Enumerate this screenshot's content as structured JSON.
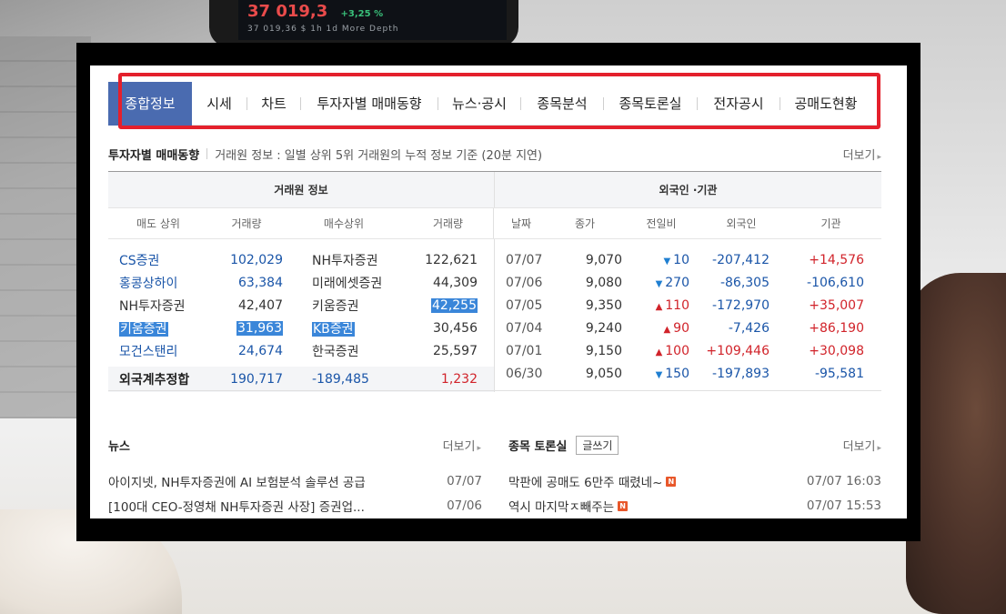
{
  "phone": {
    "price": "37 019,3",
    "change": "+3,25 %",
    "sub": "37 019,36 $    1h   1d   More   Depth"
  },
  "tabs": [
    "종합정보",
    "시세",
    "차트",
    "투자자별 매매동향",
    "뉴스·공시",
    "종목분석",
    "종목토론실",
    "전자공시",
    "공매도현황"
  ],
  "section": {
    "title": "투자자별 매매동향",
    "desc": "거래원 정보 : 일별 상위 5위 거래원의 누적 정보 기준 (20분 지연)",
    "more": "더보기"
  },
  "table": {
    "group_left": "거래원 정보",
    "group_right": "외국인 ·기관",
    "cols_left": [
      "매도 상위",
      "거래량",
      "매수상위",
      "거래량"
    ],
    "cols_right": [
      "날짜",
      "종가",
      "전일비",
      "외국인",
      "기관"
    ],
    "brokers": [
      {
        "sell": "CS증권",
        "sell_vol": "102,029",
        "buy": "NH투자증권",
        "buy_vol": "122,621"
      },
      {
        "sell": "홍콩상하이",
        "sell_vol": "63,384",
        "buy": "미래에셋증권",
        "buy_vol": "44,309"
      },
      {
        "sell": "NH투자증권",
        "sell_vol": "42,407",
        "buy": "키움증권",
        "buy_vol": "42,255"
      },
      {
        "sell": "키움증권",
        "sell_vol": "31,963",
        "buy": "KB증권",
        "buy_vol": "30,456"
      },
      {
        "sell": "모건스탠리",
        "sell_vol": "24,674",
        "buy": "한국증권",
        "buy_vol": "25,597"
      }
    ],
    "summary": {
      "label": "외국계추정합",
      "sell": "190,717",
      "buy": "-189,485",
      "net": "1,232"
    },
    "daily": [
      {
        "date": "07/07",
        "close": "9,070",
        "dir": "down",
        "chg": "10",
        "foreign": "-207,412",
        "inst": "+14,576"
      },
      {
        "date": "07/06",
        "close": "9,080",
        "dir": "down",
        "chg": "270",
        "foreign": "-86,305",
        "inst": "-106,610"
      },
      {
        "date": "07/05",
        "close": "9,350",
        "dir": "up",
        "chg": "110",
        "foreign": "-172,970",
        "inst": "+35,007"
      },
      {
        "date": "07/04",
        "close": "9,240",
        "dir": "up",
        "chg": "90",
        "foreign": "-7,426",
        "inst": "+86,190"
      },
      {
        "date": "07/01",
        "close": "9,150",
        "dir": "up",
        "chg": "100",
        "foreign": "+109,446",
        "inst": "+30,098"
      },
      {
        "date": "06/30",
        "close": "9,050",
        "dir": "down",
        "chg": "150",
        "foreign": "-197,893",
        "inst": "-95,581"
      }
    ]
  },
  "news": {
    "title": "뉴스",
    "more": "더보기",
    "items": [
      {
        "text": "아이지넷, NH투자증권에 AI 보험분석 솔루션 공급",
        "date": "07/07"
      },
      {
        "text": "[100대 CEO-정영채 NH투자증권 사장] 증권업...",
        "date": "07/06"
      }
    ]
  },
  "discussion": {
    "title": "종목 토론실",
    "write": "글쓰기",
    "more": "더보기",
    "badge": "N",
    "items": [
      {
        "text": "막판에 공매도 6만주 때렸네~",
        "date": "07/07 16:03"
      },
      {
        "text": "역시 마지막ㅈ빼주는",
        "date": "07/07 15:53"
      }
    ]
  },
  "colors": {
    "tab_active": "#4a6bb0",
    "highlight_box": "#e4202c",
    "up": "#d1232a",
    "down": "#1f7fd1",
    "link": "#1a55a8"
  }
}
